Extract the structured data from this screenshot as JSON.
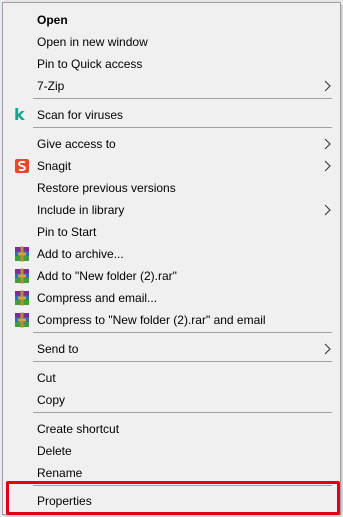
{
  "context_menu": {
    "items": [
      {
        "label": "Open"
      },
      {
        "label": "Open in new window"
      },
      {
        "label": "Pin to Quick access"
      },
      {
        "label": "7-Zip"
      },
      {
        "label": "Scan for viruses"
      },
      {
        "label": "Give access to"
      },
      {
        "label": "Snagit"
      },
      {
        "label": "Restore previous versions"
      },
      {
        "label": "Include in library"
      },
      {
        "label": "Pin to Start"
      },
      {
        "label": "Add to archive..."
      },
      {
        "label": "Add to \"New folder (2).rar\""
      },
      {
        "label": "Compress and email..."
      },
      {
        "label": "Compress to \"New folder (2).rar\" and email"
      },
      {
        "label": "Send to"
      },
      {
        "label": "Cut"
      },
      {
        "label": "Copy"
      },
      {
        "label": "Create shortcut"
      },
      {
        "label": "Delete"
      },
      {
        "label": "Rename"
      },
      {
        "label": "Properties"
      }
    ],
    "scan_icon_glyph": "k",
    "icons": {
      "scan": "kaspersky-icon",
      "snagit": "snagit-icon",
      "winrar": "winrar-icon",
      "submenu": "chevron-right-icon"
    },
    "colors": {
      "menu_bg": "#f0f0f0",
      "separator": "#a0a0a0",
      "highlight_border": "#e3000f",
      "scan_icon": "#16a38f",
      "snagit_icon": "#e8472a"
    }
  }
}
